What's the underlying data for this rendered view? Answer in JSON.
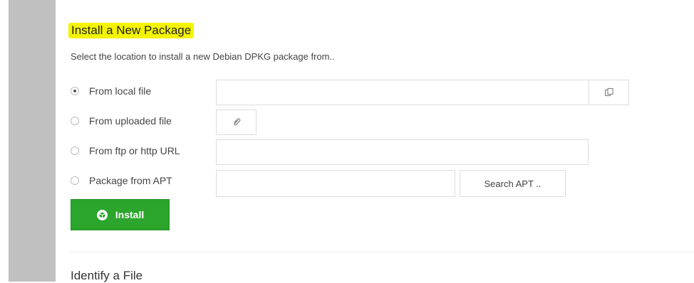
{
  "install": {
    "title": "Install a New Package",
    "description": "Select the location to install a new Debian DPKG package from..",
    "options": [
      {
        "label": "From local file",
        "selected": true
      },
      {
        "label": "From uploaded file",
        "selected": false
      },
      {
        "label": "From ftp or http URL",
        "selected": false
      },
      {
        "label": "Package from APT",
        "selected": false
      }
    ],
    "local_file_value": "",
    "url_value": "",
    "apt_value": "",
    "search_apt_label": "Search APT ..",
    "install_label": "Install"
  },
  "identify": {
    "title": "Identify a File"
  },
  "icons": {
    "file_chooser": "file-chooser-icon",
    "attachment": "paperclip-icon",
    "install": "package-icon"
  },
  "colors": {
    "highlight": "#f4f400",
    "install_button": "#2ba52b",
    "sidebar": "#c0c0c0"
  }
}
